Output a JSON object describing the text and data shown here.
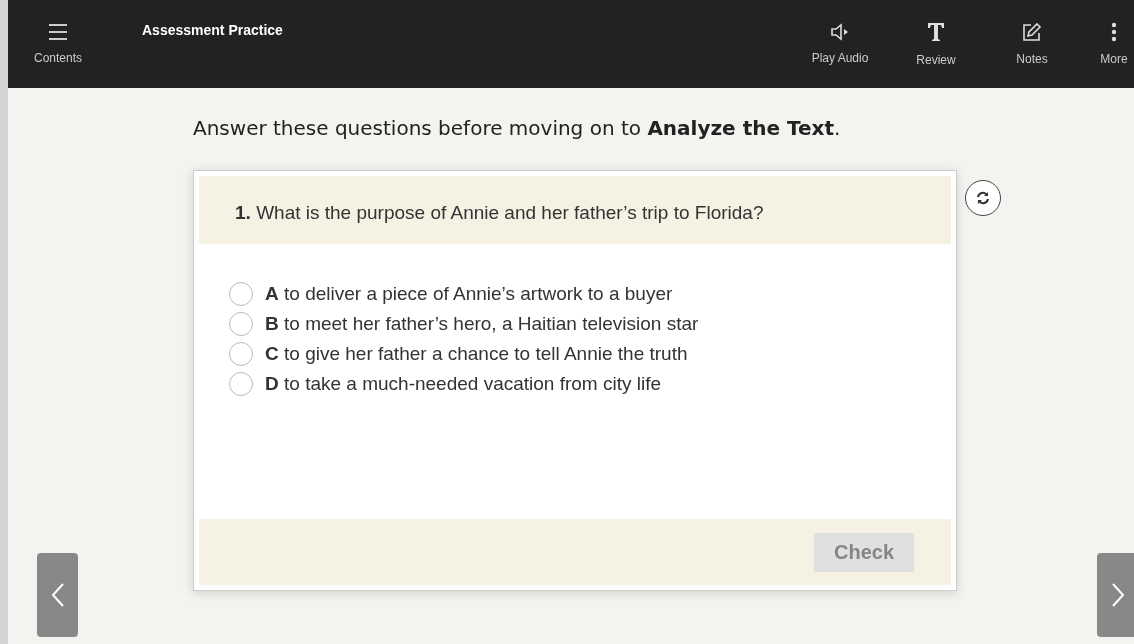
{
  "toolbar": {
    "menu_label": "Contents",
    "title": "Assessment Practice",
    "actions": [
      {
        "kind": "audio",
        "label": "Play Audio"
      },
      {
        "kind": "review",
        "label": "Review"
      },
      {
        "kind": "notes",
        "label": "Notes"
      },
      {
        "kind": "more",
        "label": "More"
      }
    ]
  },
  "instruction": "Answer these questions before moving on to **Analyze the Text**.",
  "question": {
    "number": "1.",
    "text": "What is the purpose of Annie and her father’s trip to Florida?",
    "options": [
      {
        "letter": "A",
        "text": "to deliver a piece of Annie’s artwork to a buyer",
        "selected": false
      },
      {
        "letter": "B",
        "text": "to meet her father’s hero, a Haitian television star",
        "selected": false
      },
      {
        "letter": "C",
        "text": "to give her father a chance to tell Annie the truth",
        "selected": false
      },
      {
        "letter": "D",
        "text": "to take a much-needed vacation from city life",
        "selected": false
      }
    ]
  },
  "check_button": {
    "label": "Check",
    "disabled": true
  }
}
